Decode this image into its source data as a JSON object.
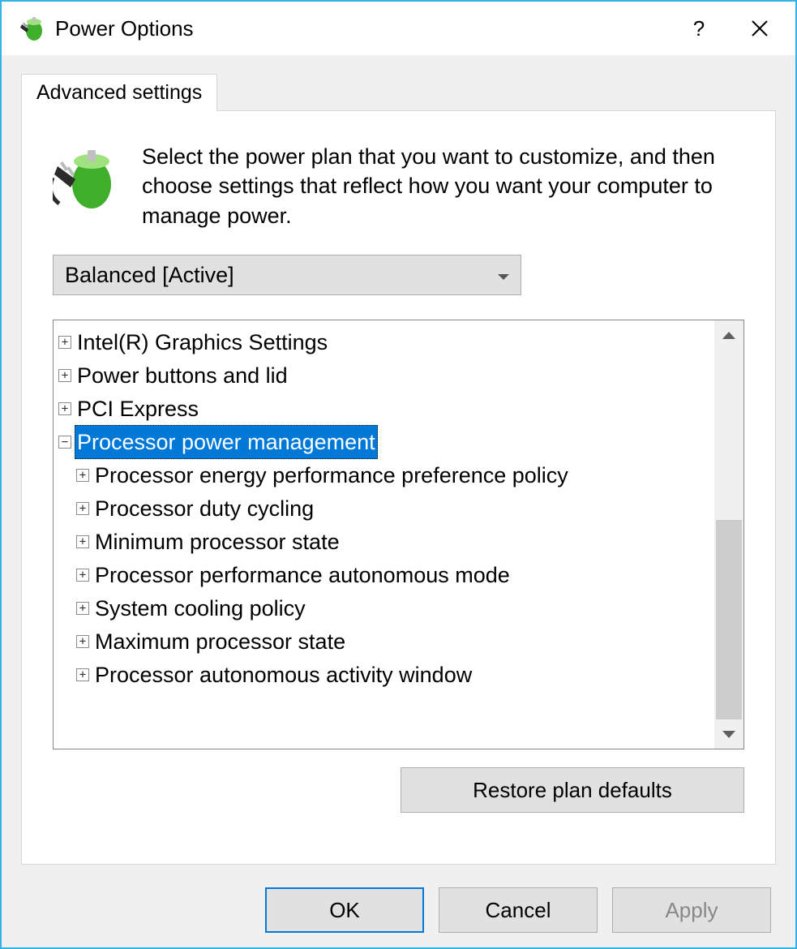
{
  "titlebar": {
    "title": "Power Options",
    "help_label": "?"
  },
  "tab": {
    "label": "Advanced settings"
  },
  "intro": {
    "text": "Select the power plan that you want to customize, and then choose settings that reflect how you want your computer to manage power."
  },
  "plan": {
    "selected": "Balanced [Active]"
  },
  "tree": {
    "items": [
      {
        "level": 0,
        "toggle": "+",
        "label": "Intel(R) Graphics Settings",
        "selected": false
      },
      {
        "level": 0,
        "toggle": "+",
        "label": "Power buttons and lid",
        "selected": false
      },
      {
        "level": 0,
        "toggle": "+",
        "label": "PCI Express",
        "selected": false
      },
      {
        "level": 0,
        "toggle": "−",
        "label": "Processor power management",
        "selected": true
      },
      {
        "level": 1,
        "toggle": "+",
        "label": "Processor energy performance preference policy",
        "selected": false
      },
      {
        "level": 1,
        "toggle": "+",
        "label": "Processor duty cycling",
        "selected": false
      },
      {
        "level": 1,
        "toggle": "+",
        "label": "Minimum processor state",
        "selected": false
      },
      {
        "level": 1,
        "toggle": "+",
        "label": "Processor performance autonomous mode",
        "selected": false
      },
      {
        "level": 1,
        "toggle": "+",
        "label": "System cooling policy",
        "selected": false
      },
      {
        "level": 1,
        "toggle": "+",
        "label": "Maximum processor state",
        "selected": false
      },
      {
        "level": 1,
        "toggle": "+",
        "label": "Processor autonomous activity window",
        "selected": false
      }
    ]
  },
  "buttons": {
    "restore": "Restore plan defaults",
    "ok": "OK",
    "cancel": "Cancel",
    "apply": "Apply"
  }
}
